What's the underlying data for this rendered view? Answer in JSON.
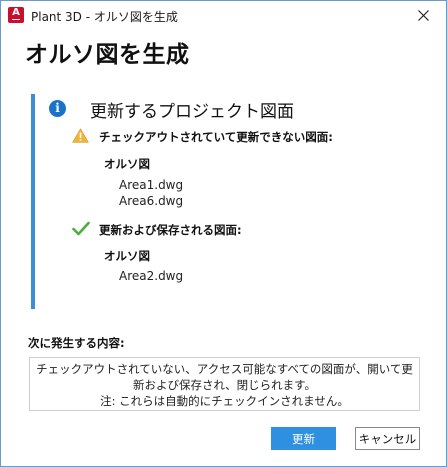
{
  "window": {
    "title": "Plant 3D - オルソ図を生成",
    "icon": "autocad-plant3d-icon",
    "close_icon": "close-icon"
  },
  "heading": "オルソ図を生成",
  "panel": {
    "title": "更新するプロジェクト図面",
    "accent_color": "#3c8fd6",
    "sections": [
      {
        "icon": "warning-icon",
        "label": "チェックアウトされていて更新できない図面:",
        "group": "オルソ図",
        "files": [
          "Area1.dwg",
          "Area6.dwg"
        ]
      },
      {
        "icon": "checkmark-icon",
        "label": "更新および保存される図面:",
        "group": "オルソ図",
        "files": [
          "Area2.dwg"
        ]
      }
    ]
  },
  "next": {
    "label": "次に発生する内容:",
    "lines": [
      "チェックアウトされていない、アクセス可能なすべての図面が、開いて更",
      "新および保存され、閉じられます。",
      "注: これらは自動的にチェックインされません。"
    ]
  },
  "buttons": {
    "update": "更新",
    "cancel": "キャンセル",
    "primary_color": "#2f8fe0"
  }
}
